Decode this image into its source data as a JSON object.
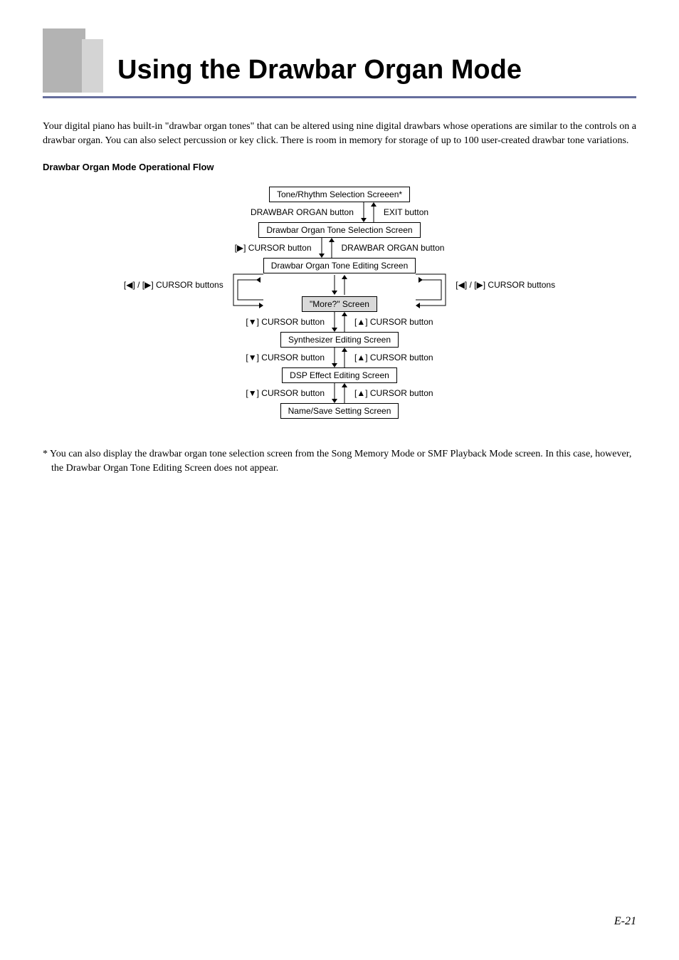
{
  "title": "Using the Drawbar Organ Mode",
  "intro": "Your digital piano has built-in \"drawbar organ tones\" that can be altered using nine digital drawbars whose operations are similar to the controls on a drawbar organ. You can also select percussion or key click. There is room in memory for storage of up to 100 user-created drawbar tone variations.",
  "subhead": "Drawbar Organ Mode Operational Flow",
  "flow": {
    "n1": "Tone/Rhythm Selection Screeen*",
    "a1l": "DRAWBAR ORGAN button",
    "a1r": "EXIT button",
    "n2": "Drawbar Organ Tone Selection Screen",
    "a2l": "[▶] CURSOR button",
    "a2r": "DRAWBAR ORGAN button",
    "n3": "Drawbar Organ Tone Editing Screen",
    "side_l": "[◀] / [▶] CURSOR buttons",
    "side_r": "[◀] / [▶] CURSOR buttons",
    "n4": "\"More?\" Screen",
    "a4l": "[▼] CURSOR button",
    "a4r": "[▲] CURSOR button",
    "n5": "Synthesizer Editing Screen",
    "a5l": "[▼] CURSOR button",
    "a5r": "[▲] CURSOR button",
    "n6": "DSP Effect Editing Screen",
    "a6l": "[▼] CURSOR button",
    "a6r": "[▲] CURSOR button",
    "n7": "Name/Save Setting Screen"
  },
  "footnote": "* You can also display the drawbar organ tone selection screen from the Song Memory Mode or SMF Playback Mode screen. In this case, however, the Drawbar Organ Tone Editing Screen does not appear.",
  "pagenum": "E-21"
}
